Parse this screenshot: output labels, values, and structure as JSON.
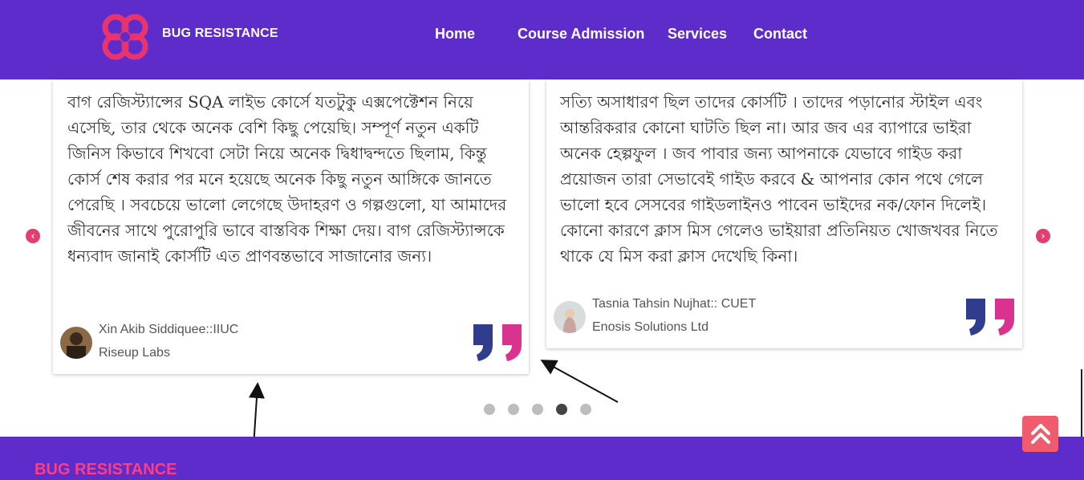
{
  "header": {
    "brand": "BUG RESISTANCE",
    "nav": [
      "Home",
      "Course Admission",
      "Services",
      "Contact"
    ]
  },
  "testimonials": [
    {
      "text": "বাগ রেজিস্ট্যান্সের SQA লাইভ কোর্সে যতটুকু এক্সপেক্টেশন নিয়ে এসেছি, তার থেকে অনেক বেশি কিছু পেয়েছি। সম্পূর্ণ নতুন একটি জিনিস কিভাবে শিখবো সেটা নিয়ে অনেক দ্বিধাদ্বন্দতে ছিলাম, কিন্তু কোর্স শেষ করার পর মনে হয়েছে অনেক কিছু নতুন আঙ্গিকে জানতে পেরেছি । সবচেয়ে ভালো লেগেছে উদাহরণ ও গল্পগুলো, যা আমাদের জীবনের সাথে পুরোপুরি ভাবে বাস্তবিক শিক্ষা দেয়। বাগ রেজিস্ট্যান্সকে ধন্যবাদ জানাই কোর্সটি এত প্রাণবন্তভাবে সাজানোর জন্য।",
      "name": "Xin Akib Siddiquee::IIUC",
      "org": "Riseup Labs"
    },
    {
      "text": "সত্যি অসাধারণ ছিল তাদের কোর্সটি । তাদের পড়ানোর স্টাইল এবং আন্তরিকরার কোনো ঘাটতি ছিল না। আর জব এর ব্যাপারে ভাইরা অনেক হেল্পফুল । জব পাবার জন্য আপনাকে যেভাবে গাইড করা প্রয়োজন তারা সেভাবেই গাইড করবে & আপনার কোন পথে গেলে ভালো হবে সেসবের গাইডলাইনও পাবেন ভাইদের নক/ফোন দিলেই। কোনো কারণে ক্লাস মিস গেলেও ভাইয়ারা প্রতিনিয়ত খোজখবর নিতে থাকে যে মিস করা ক্লাস দেখেছি কিনা।",
      "name": "Tasnia Tahsin Nujhat:: CUET",
      "org": "Enosis Solutions Ltd"
    }
  ],
  "carousel": {
    "prev_icon": "chevron-left-icon",
    "next_icon": "chevron-right-icon",
    "dot_count": 5,
    "active_index": 3
  },
  "footer": {
    "brand": "BUG RESISTANCE"
  },
  "colors": {
    "header_bg": "#5f2ccc",
    "accent_pink": "#e23e6e",
    "quote_blue": "#2f3d8c",
    "quote_pink": "#d9338f"
  }
}
